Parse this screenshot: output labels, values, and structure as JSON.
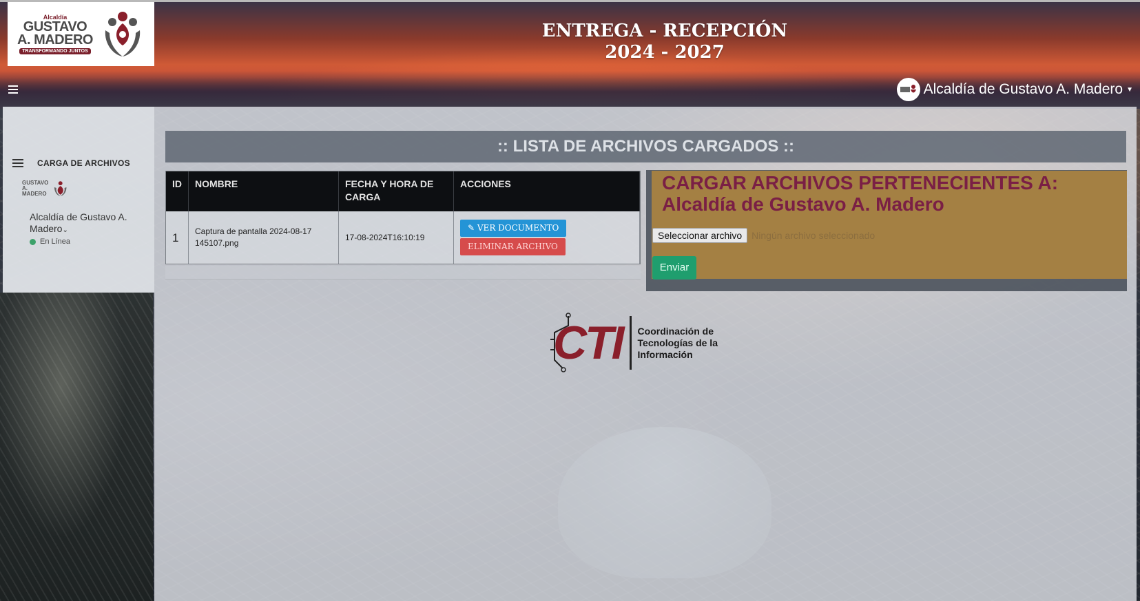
{
  "header": {
    "logo": {
      "small": "Alcaldía",
      "line1": "GUSTAVO",
      "line2": "A. MADERO",
      "tagline": "TRANSFORMANDO JUNTOS"
    },
    "title_line1": "ENTREGA - RECEPCIÓN",
    "title_line2": "2024 - 2027",
    "user_name": "Alcaldía de Gustavo A. Madero"
  },
  "sidebar": {
    "user_name": "Alcaldía de Gustavo A. Madero",
    "status": "En Línea",
    "nav_item": "CARGA DE ARCHIVOS"
  },
  "main": {
    "list_title": ":: LISTA DE ARCHIVOS CARGADOS ::",
    "table": {
      "headers": [
        "ID",
        "NOMBRE",
        "FECHA Y HORA DE CARGA",
        "ACCIONES"
      ],
      "rows": [
        {
          "id": "1",
          "name": "Captura de pantalla 2024-08-17 145107.png",
          "datetime": "17-08-2024T16:10:19",
          "view_label": "VER DOCUMENTO",
          "delete_label": "ELIMINAR ARCHIVO"
        }
      ]
    },
    "upload": {
      "title_line1": "CARGAR ARCHIVOS PERTENECIENTES A:",
      "title_line2": "Alcaldía de Gustavo A. Madero",
      "file_button": "Seleccionar archivo",
      "file_status": "Ningún archivo seleccionado",
      "submit": "Enviar"
    }
  },
  "footer_logo": {
    "letters": "CTI",
    "line1": "Coordinación de",
    "line2": "Tecnologías de la",
    "line3": "Información"
  },
  "colors": {
    "brand": "#7a1f2b",
    "view_button": "#2494d6",
    "delete_button": "#d64b4b",
    "submit_button": "#1f9e6e",
    "status_online": "#3ca26a"
  }
}
